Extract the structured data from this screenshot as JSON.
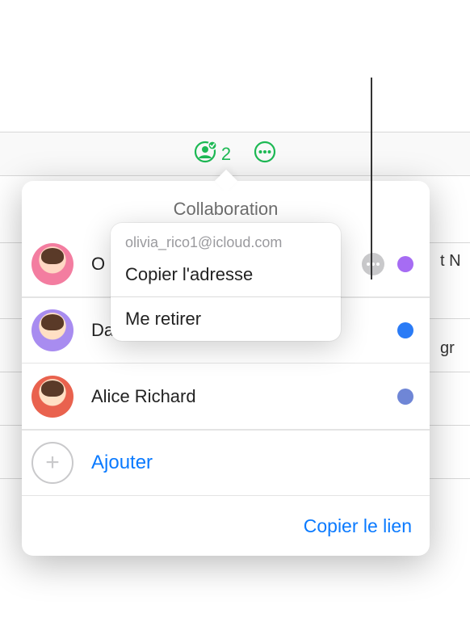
{
  "accent_color": "#1DB954",
  "link_color": "#0a7aff",
  "toolbar": {
    "collab_count": "2"
  },
  "popover": {
    "title": "Collaboration",
    "add_label": "Ajouter",
    "copy_link_label": "Copier le lien"
  },
  "participants": [
    {
      "name": "O",
      "avatar_class": "pink",
      "dot_color": "#a66cf3",
      "has_more": true
    },
    {
      "name": "Daniel Richard (propriétaire)",
      "avatar_class": "purple",
      "dot_color": "#2a7bf6",
      "has_more": false
    },
    {
      "name": "Alice Richard",
      "avatar_class": "red",
      "dot_color": "#6f86d6",
      "has_more": false
    }
  ],
  "context_menu": {
    "email": "olivia_rico1@icloud.com",
    "copy_address": "Copier l'adresse",
    "remove_me": "Me retirer"
  },
  "background": {
    "cell1": "t N",
    "cell2": "gr"
  }
}
